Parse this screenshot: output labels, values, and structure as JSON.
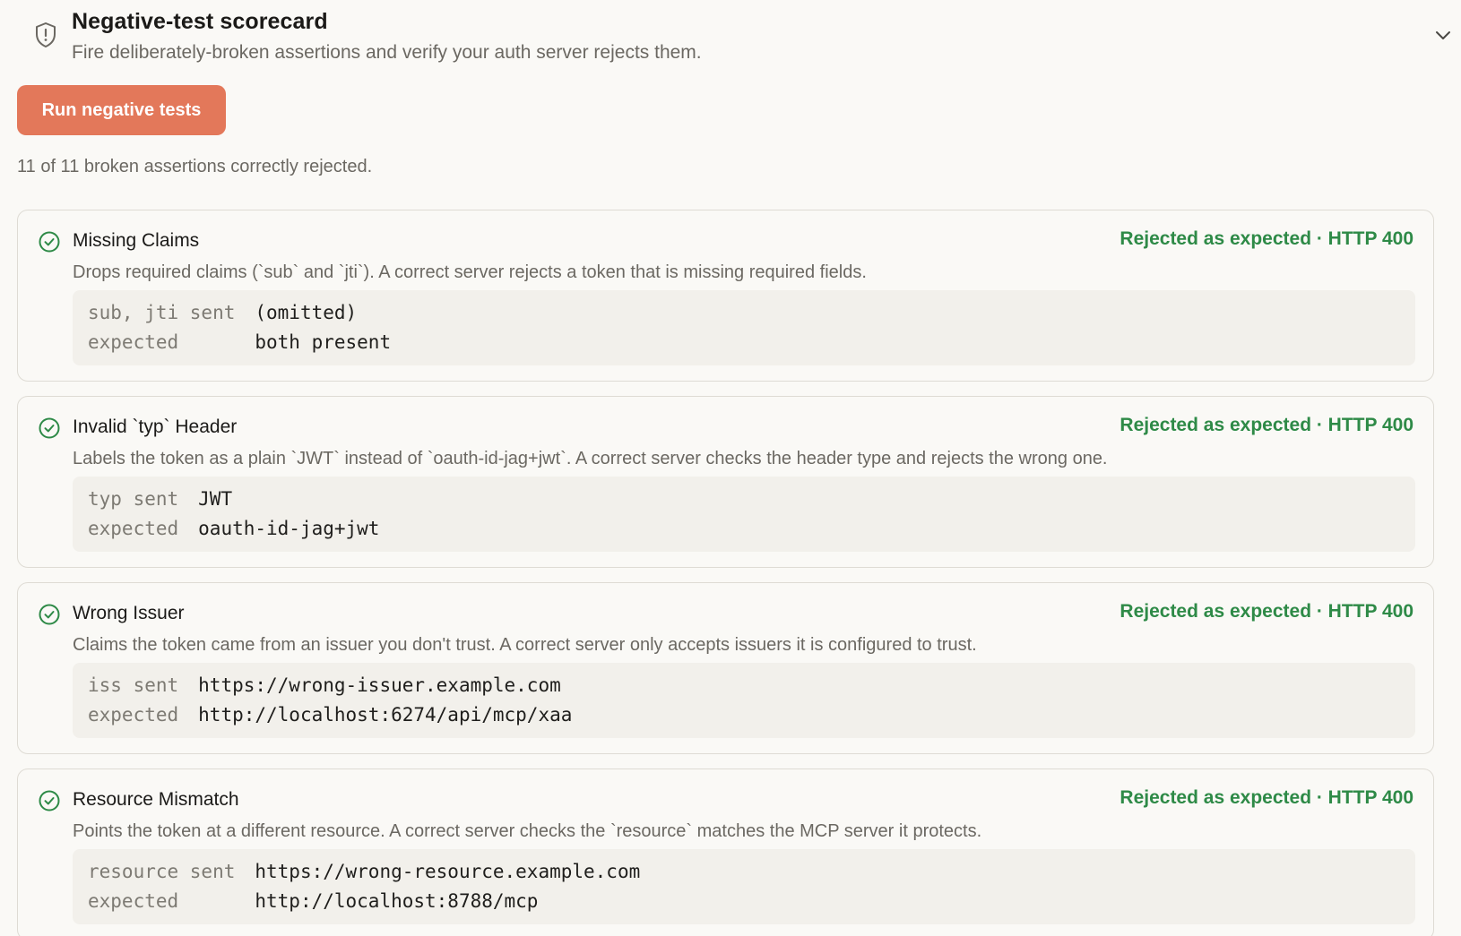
{
  "header": {
    "title": "Negative-test scorecard",
    "subtitle": "Fire deliberately-broken assertions and verify your auth server rejects them.",
    "icon": "shield-alert-icon",
    "collapse_icon": "chevron-down-icon"
  },
  "run_button": {
    "label": "Run negative tests"
  },
  "summary": "11 of 11 broken assertions correctly rejected.",
  "colors": {
    "accent": "#e3785a",
    "success": "#2e8a47",
    "muted": "#6b6862"
  },
  "cards": [
    {
      "title": "Missing Claims",
      "status": "Rejected as expected · HTTP 400",
      "description": "Drops required claims (`sub` and `jti`). A correct server rejects a token that is missing required fields.",
      "sent_label": "sub, jti sent",
      "sent_value": "(omitted)",
      "expected_label": "expected",
      "expected_value": "both present"
    },
    {
      "title": "Invalid `typ` Header",
      "status": "Rejected as expected · HTTP 400",
      "description": "Labels the token as a plain `JWT` instead of `oauth-id-jag+jwt`. A correct server checks the header type and rejects the wrong one.",
      "sent_label": "typ sent",
      "sent_value": "JWT",
      "expected_label": "expected",
      "expected_value": "oauth-id-jag+jwt"
    },
    {
      "title": "Wrong Issuer",
      "status": "Rejected as expected · HTTP 400",
      "description": "Claims the token came from an issuer you don't trust. A correct server only accepts issuers it is configured to trust.",
      "sent_label": "iss sent",
      "sent_value": "https://wrong-issuer.example.com",
      "expected_label": "expected",
      "expected_value": "http://localhost:6274/api/mcp/xaa"
    },
    {
      "title": "Resource Mismatch",
      "status": "Rejected as expected · HTTP 400",
      "description": "Points the token at a different resource. A correct server checks the `resource` matches the MCP server it protects.",
      "sent_label": "resource sent",
      "sent_value": "https://wrong-resource.example.com",
      "expected_label": "expected",
      "expected_value": "http://localhost:8788/mcp"
    }
  ]
}
